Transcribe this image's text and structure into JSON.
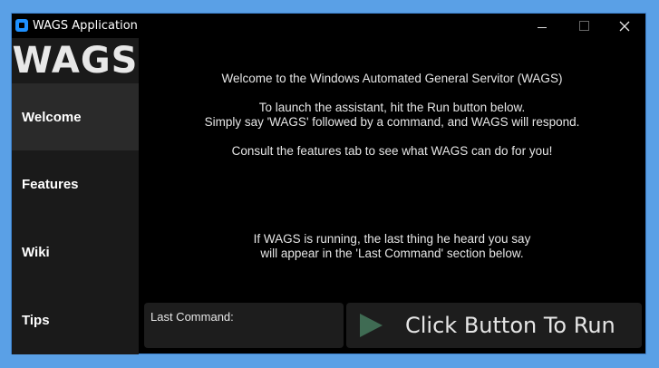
{
  "window": {
    "title": "WAGS Application"
  },
  "sidebar": {
    "logo": "WAGS",
    "items": [
      {
        "label": "Welcome",
        "active": true
      },
      {
        "label": "Features",
        "active": false
      },
      {
        "label": "Wiki",
        "active": false
      },
      {
        "label": "Tips",
        "active": false
      }
    ]
  },
  "main": {
    "lines": [
      "Welcome to the Windows Automated General Servitor (WAGS)",
      "To launch the assistant, hit the Run button below.",
      "Simply say 'WAGS' followed by a command, and WAGS will respond.",
      "Consult the features tab to see what WAGS can do for you!",
      "If WAGS is running, the last thing he heard you say",
      "will appear in the 'Last Command' section below."
    ],
    "last_command_label": "Last Command:",
    "run_button_label": "Click Button To Run"
  },
  "icons": {
    "app": "app-icon",
    "minimize": "minimize-icon",
    "maximize": "maximize-icon",
    "close": "close-icon",
    "run": "play-icon"
  },
  "colors": {
    "background": "#5aa0e6",
    "window": "#000000",
    "sidebar": "#1a1a1a",
    "sidebar_active": "#2a2a2a",
    "panel": "#1d1d1d",
    "play": "#3f6b53"
  }
}
